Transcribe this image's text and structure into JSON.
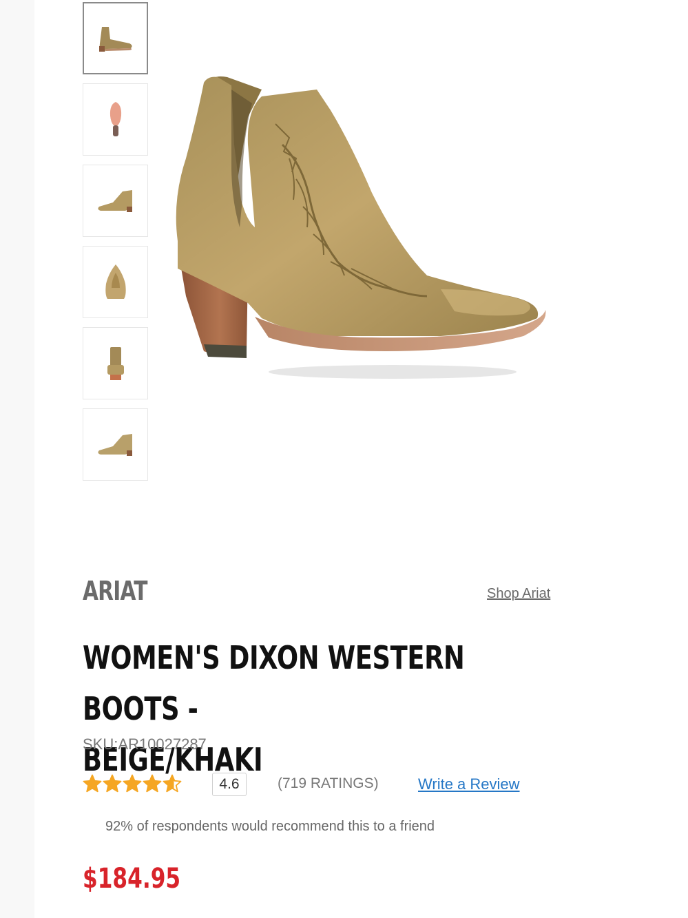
{
  "gallery": {
    "thumbnails": [
      {
        "view": "angled-side"
      },
      {
        "view": "sole"
      },
      {
        "view": "side"
      },
      {
        "view": "front"
      },
      {
        "view": "back"
      },
      {
        "view": "side-alt"
      }
    ],
    "main_image_alt": "boot-photo"
  },
  "product": {
    "brand": "ARIAT",
    "shop_link": "Shop Ariat",
    "title_line1": "WOMEN'S DIXON WESTERN BOOTS -",
    "title_line2": "BEIGE/KHAKI",
    "sku": "SKU:AR10027287",
    "rating_value": "4.6",
    "stars": 4.6,
    "ratings_count": "(719 RATINGS)",
    "write_review": "Write a Review",
    "recommend_text": "92% of respondents would recommend this to a friend",
    "price": "$184.95"
  },
  "colors": {
    "star": "#f5a623",
    "price": "#d8232a",
    "link": "#2577c6"
  }
}
